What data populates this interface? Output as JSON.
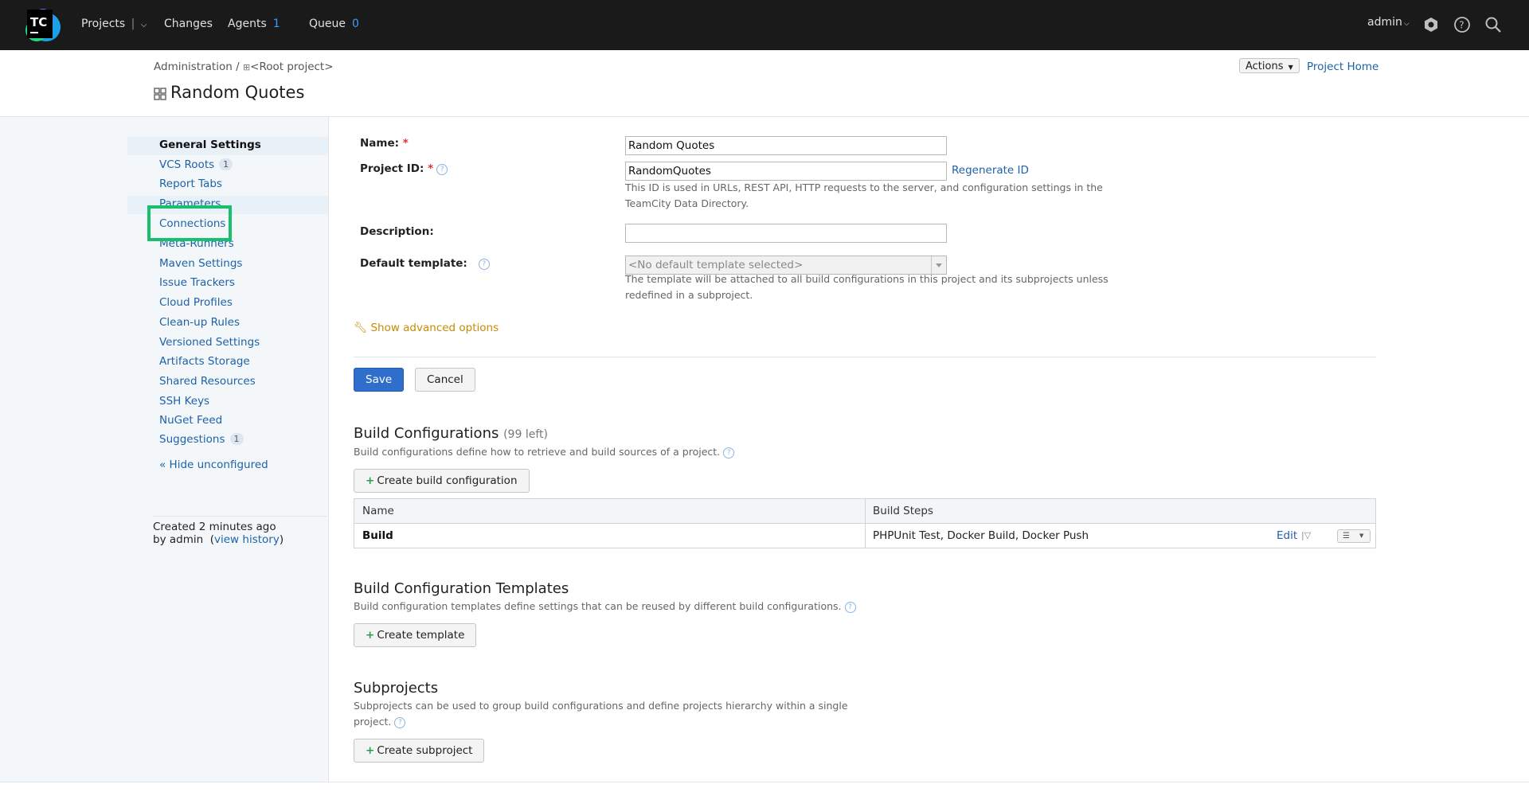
{
  "topbar": {
    "logo_text": "TC",
    "projects": "Projects",
    "changes": "Changes",
    "agents": "Agents",
    "agents_count": "1",
    "queue": "Queue",
    "queue_count": "0",
    "user": "admin"
  },
  "header": {
    "breadcrumb_admin": "Administration",
    "breadcrumb_sep": "/",
    "breadcrumb_root": "<Root project>",
    "title": "Random Quotes",
    "actions": "Actions",
    "project_home": "Project Home"
  },
  "sidebar": {
    "items": [
      {
        "label": "General Settings"
      },
      {
        "label": "VCS Roots",
        "badge": "1"
      },
      {
        "label": "Report Tabs"
      },
      {
        "label": "Parameters"
      },
      {
        "label": "Connections"
      },
      {
        "label": "Meta-Runners"
      },
      {
        "label": "Maven Settings"
      },
      {
        "label": "Issue Trackers"
      },
      {
        "label": "Cloud Profiles"
      },
      {
        "label": "Clean-up Rules"
      },
      {
        "label": "Versioned Settings"
      },
      {
        "label": "Artifacts Storage"
      },
      {
        "label": "Shared Resources"
      },
      {
        "label": "SSH Keys"
      },
      {
        "label": "NuGet Feed"
      },
      {
        "label": "Suggestions",
        "badge": "1"
      }
    ],
    "hide_unconfigured": "« Hide unconfigured",
    "created_line": "Created 2 minutes ago",
    "by_admin": "by admin",
    "view_history": "view history"
  },
  "form": {
    "name_label": "Name:",
    "name_value": "Random Quotes",
    "id_label": "Project ID:",
    "id_value": "RandomQuotes",
    "regenerate": "Regenerate ID",
    "id_note": "This ID is used in URLs, REST API, HTTP requests to the server, and configuration settings in the TeamCity Data Directory.",
    "description_label": "Description:",
    "description_value": "",
    "template_label": "Default template:",
    "template_value": "<No default template selected>",
    "template_note": "The template will be attached to all build configurations in this project and its subprojects unless redefined in a subproject.",
    "advanced": "Show advanced options",
    "save": "Save",
    "cancel": "Cancel",
    "required_mark": "*"
  },
  "build_configs": {
    "title": "Build Configurations",
    "left": "(99 left)",
    "desc": "Build configurations define how to retrieve and build sources of a project.",
    "create": "Create build configuration",
    "col_name": "Name",
    "col_steps": "Build Steps",
    "rows": [
      {
        "name": "Build",
        "steps": "PHPUnit Test, Docker Build, Docker Push",
        "edit": "Edit"
      }
    ]
  },
  "templates": {
    "title": "Build Configuration Templates",
    "desc": "Build configuration templates define settings that can be reused by different build configurations.",
    "create": "Create template"
  },
  "subprojects": {
    "title": "Subprojects",
    "desc_line1": "Subprojects can be used to group build configurations and define projects hierarchy within a single",
    "desc_line2": "project.",
    "create": "Create subproject"
  },
  "colors": {
    "topbar_bg": "#1a1a1b",
    "link": "#1d62a7",
    "primary": "#2f6fcb",
    "focus": "#18c06b",
    "advanced": "#c98a06"
  }
}
